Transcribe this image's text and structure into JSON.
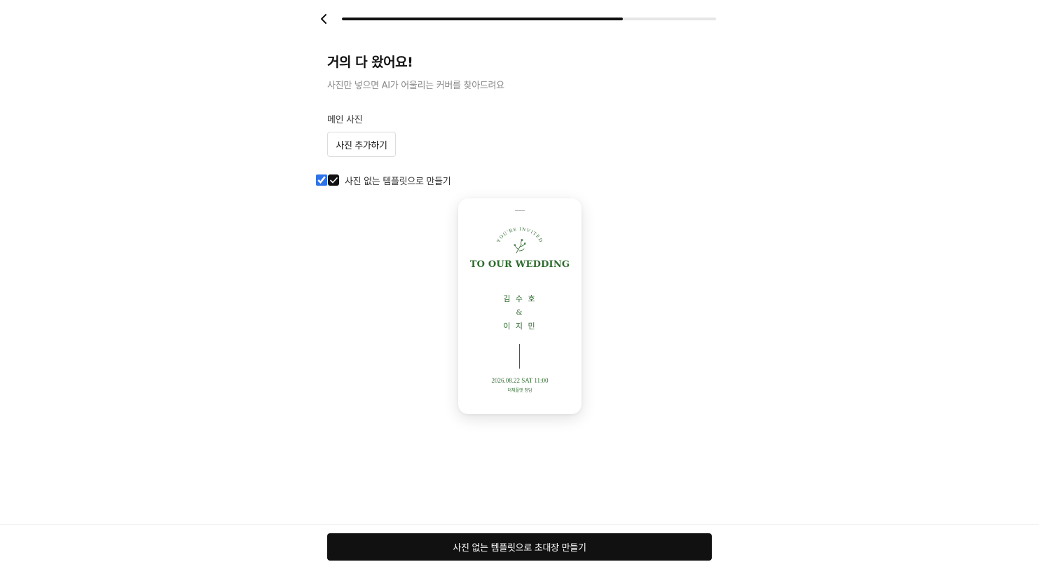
{
  "header": {
    "back_icon": "chevron-left-icon",
    "progress_fraction": 0.75
  },
  "heading": {
    "title": "거의 다 왔어요!",
    "subtitle": "사진만 넣으면 AI가 어울리는 커버를 찾아드려요"
  },
  "photo": {
    "label": "메인 사진",
    "add_button": "사진 추가하기"
  },
  "no_photo_option": {
    "label": "사진 없는 템플릿으로 만들기",
    "checked": true
  },
  "preview": {
    "arc_text": "YOU'RE INVITED",
    "title": "TO OUR WEDDING",
    "groom": "김 수 호",
    "ampersand": "&",
    "bride": "이 지 민",
    "date": "2026.08.22 SAT 11:00",
    "venue": "더채플앳 청담",
    "accent_color": "#2e6b2e"
  },
  "cta": {
    "label": "사진 없는 템플릿으로 초대장 만들기"
  }
}
